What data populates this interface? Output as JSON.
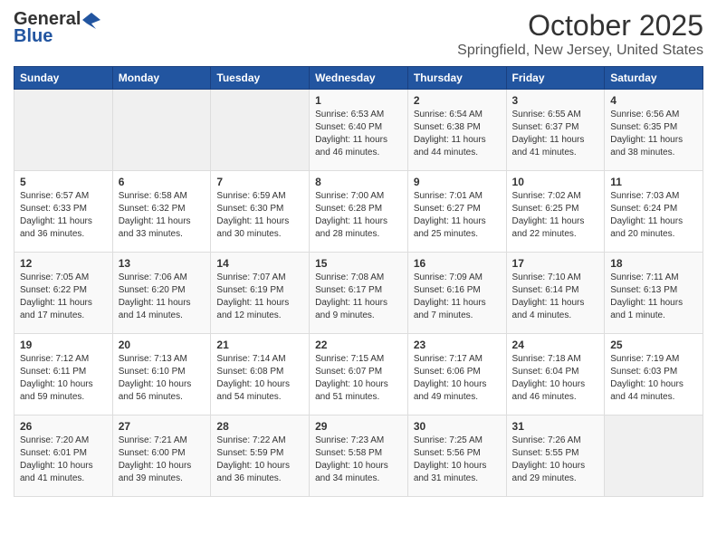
{
  "header": {
    "logo_general": "General",
    "logo_blue": "Blue",
    "month_year": "October 2025",
    "location": "Springfield, New Jersey, United States"
  },
  "days_of_week": [
    "Sunday",
    "Monday",
    "Tuesday",
    "Wednesday",
    "Thursday",
    "Friday",
    "Saturday"
  ],
  "weeks": [
    [
      {
        "day": "",
        "info": ""
      },
      {
        "day": "",
        "info": ""
      },
      {
        "day": "",
        "info": ""
      },
      {
        "day": "1",
        "info": "Sunrise: 6:53 AM\nSunset: 6:40 PM\nDaylight: 11 hours and 46 minutes."
      },
      {
        "day": "2",
        "info": "Sunrise: 6:54 AM\nSunset: 6:38 PM\nDaylight: 11 hours and 44 minutes."
      },
      {
        "day": "3",
        "info": "Sunrise: 6:55 AM\nSunset: 6:37 PM\nDaylight: 11 hours and 41 minutes."
      },
      {
        "day": "4",
        "info": "Sunrise: 6:56 AM\nSunset: 6:35 PM\nDaylight: 11 hours and 38 minutes."
      }
    ],
    [
      {
        "day": "5",
        "info": "Sunrise: 6:57 AM\nSunset: 6:33 PM\nDaylight: 11 hours and 36 minutes."
      },
      {
        "day": "6",
        "info": "Sunrise: 6:58 AM\nSunset: 6:32 PM\nDaylight: 11 hours and 33 minutes."
      },
      {
        "day": "7",
        "info": "Sunrise: 6:59 AM\nSunset: 6:30 PM\nDaylight: 11 hours and 30 minutes."
      },
      {
        "day": "8",
        "info": "Sunrise: 7:00 AM\nSunset: 6:28 PM\nDaylight: 11 hours and 28 minutes."
      },
      {
        "day": "9",
        "info": "Sunrise: 7:01 AM\nSunset: 6:27 PM\nDaylight: 11 hours and 25 minutes."
      },
      {
        "day": "10",
        "info": "Sunrise: 7:02 AM\nSunset: 6:25 PM\nDaylight: 11 hours and 22 minutes."
      },
      {
        "day": "11",
        "info": "Sunrise: 7:03 AM\nSunset: 6:24 PM\nDaylight: 11 hours and 20 minutes."
      }
    ],
    [
      {
        "day": "12",
        "info": "Sunrise: 7:05 AM\nSunset: 6:22 PM\nDaylight: 11 hours and 17 minutes."
      },
      {
        "day": "13",
        "info": "Sunrise: 7:06 AM\nSunset: 6:20 PM\nDaylight: 11 hours and 14 minutes."
      },
      {
        "day": "14",
        "info": "Sunrise: 7:07 AM\nSunset: 6:19 PM\nDaylight: 11 hours and 12 minutes."
      },
      {
        "day": "15",
        "info": "Sunrise: 7:08 AM\nSunset: 6:17 PM\nDaylight: 11 hours and 9 minutes."
      },
      {
        "day": "16",
        "info": "Sunrise: 7:09 AM\nSunset: 6:16 PM\nDaylight: 11 hours and 7 minutes."
      },
      {
        "day": "17",
        "info": "Sunrise: 7:10 AM\nSunset: 6:14 PM\nDaylight: 11 hours and 4 minutes."
      },
      {
        "day": "18",
        "info": "Sunrise: 7:11 AM\nSunset: 6:13 PM\nDaylight: 11 hours and 1 minute."
      }
    ],
    [
      {
        "day": "19",
        "info": "Sunrise: 7:12 AM\nSunset: 6:11 PM\nDaylight: 10 hours and 59 minutes."
      },
      {
        "day": "20",
        "info": "Sunrise: 7:13 AM\nSunset: 6:10 PM\nDaylight: 10 hours and 56 minutes."
      },
      {
        "day": "21",
        "info": "Sunrise: 7:14 AM\nSunset: 6:08 PM\nDaylight: 10 hours and 54 minutes."
      },
      {
        "day": "22",
        "info": "Sunrise: 7:15 AM\nSunset: 6:07 PM\nDaylight: 10 hours and 51 minutes."
      },
      {
        "day": "23",
        "info": "Sunrise: 7:17 AM\nSunset: 6:06 PM\nDaylight: 10 hours and 49 minutes."
      },
      {
        "day": "24",
        "info": "Sunrise: 7:18 AM\nSunset: 6:04 PM\nDaylight: 10 hours and 46 minutes."
      },
      {
        "day": "25",
        "info": "Sunrise: 7:19 AM\nSunset: 6:03 PM\nDaylight: 10 hours and 44 minutes."
      }
    ],
    [
      {
        "day": "26",
        "info": "Sunrise: 7:20 AM\nSunset: 6:01 PM\nDaylight: 10 hours and 41 minutes."
      },
      {
        "day": "27",
        "info": "Sunrise: 7:21 AM\nSunset: 6:00 PM\nDaylight: 10 hours and 39 minutes."
      },
      {
        "day": "28",
        "info": "Sunrise: 7:22 AM\nSunset: 5:59 PM\nDaylight: 10 hours and 36 minutes."
      },
      {
        "day": "29",
        "info": "Sunrise: 7:23 AM\nSunset: 5:58 PM\nDaylight: 10 hours and 34 minutes."
      },
      {
        "day": "30",
        "info": "Sunrise: 7:25 AM\nSunset: 5:56 PM\nDaylight: 10 hours and 31 minutes."
      },
      {
        "day": "31",
        "info": "Sunrise: 7:26 AM\nSunset: 5:55 PM\nDaylight: 10 hours and 29 minutes."
      },
      {
        "day": "",
        "info": ""
      }
    ]
  ]
}
